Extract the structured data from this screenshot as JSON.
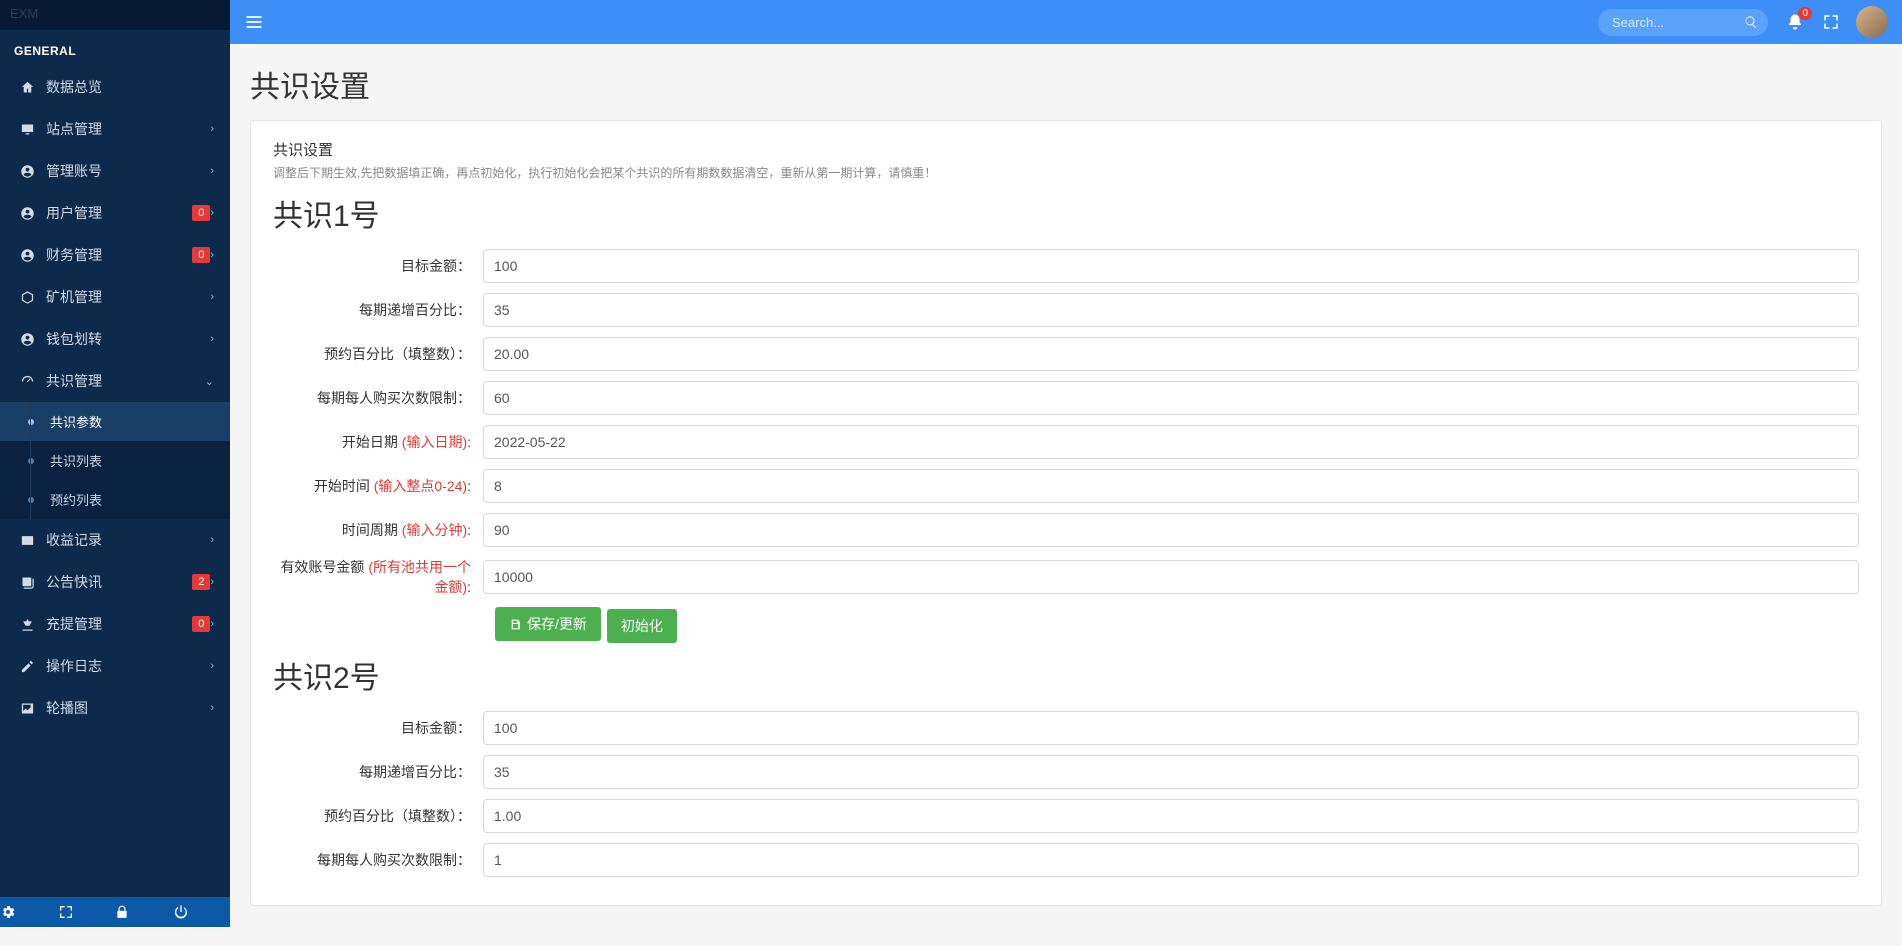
{
  "brand": "EXM",
  "topbar": {
    "search_placeholder": "Search...",
    "notif_count": "0"
  },
  "sidebar": {
    "section": "GENERAL",
    "items": [
      {
        "icon": "home",
        "label": "数据总览"
      },
      {
        "icon": "monitor",
        "label": "站点管理",
        "chev": true
      },
      {
        "icon": "user-circle",
        "label": "管理账号",
        "chev": true
      },
      {
        "icon": "user-circle",
        "label": "用户管理",
        "badge": "0",
        "chev": true
      },
      {
        "icon": "user-circle",
        "label": "财务管理",
        "badge": "0",
        "chev": true
      },
      {
        "icon": "cube",
        "label": "矿机管理",
        "chev": true
      },
      {
        "icon": "user-circle",
        "label": "钱包划转",
        "chev": true
      },
      {
        "icon": "gauge",
        "label": "共识管理",
        "expanded": true,
        "sub": [
          {
            "label": "共识参数",
            "active": true
          },
          {
            "label": "共识列表"
          },
          {
            "label": "预约列表"
          }
        ]
      },
      {
        "icon": "card",
        "label": "收益记录",
        "chev": true
      },
      {
        "icon": "news",
        "label": "公告快讯",
        "badge": "2",
        "chev": true
      },
      {
        "icon": "scale",
        "label": "充提管理",
        "badge": "0",
        "chev": true
      },
      {
        "icon": "edit",
        "label": "操作日志",
        "chev": true
      },
      {
        "icon": "image",
        "label": "轮播图",
        "chev": true
      }
    ]
  },
  "page": {
    "title": "共识设置",
    "panel_head": "共识设置",
    "panel_desc": "调整后下期生效,先把数据填正确，再点初始化，执行初始化会把某个共识的所有期数数据清空，重新从第一期计算，请慎重！",
    "sections": [
      {
        "title": "共识1号",
        "fields": [
          {
            "label": "目标金额：",
            "value": "100"
          },
          {
            "label": "每期递增百分比：",
            "value": "35"
          },
          {
            "label": "预约百分比（填整数）：",
            "value": "20.00"
          },
          {
            "label": "每期每人购买次数限制：",
            "value": "60"
          },
          {
            "label": "开始日期 ",
            "hint": "(输入日期)",
            "suffix": ":",
            "value": "2022-05-22"
          },
          {
            "label": "开始时间 ",
            "hint": "(输入整点0-24)",
            "suffix": ":",
            "value": "8"
          },
          {
            "label": "时间周期 ",
            "hint": "(输入分钟)",
            "suffix": ":",
            "value": "90"
          },
          {
            "label": "有效账号金额 ",
            "hint": "(所有池共用一个金额)",
            "suffix": ":",
            "value": "10000"
          }
        ],
        "save_label": "保存/更新",
        "init_label": "初始化"
      },
      {
        "title": "共识2号",
        "fields": [
          {
            "label": "目标金额：",
            "value": "100"
          },
          {
            "label": "每期递增百分比：",
            "value": "35"
          },
          {
            "label": "预约百分比（填整数）：",
            "value": "1.00"
          },
          {
            "label": "每期每人购买次数限制：",
            "value": "1"
          }
        ]
      }
    ]
  }
}
